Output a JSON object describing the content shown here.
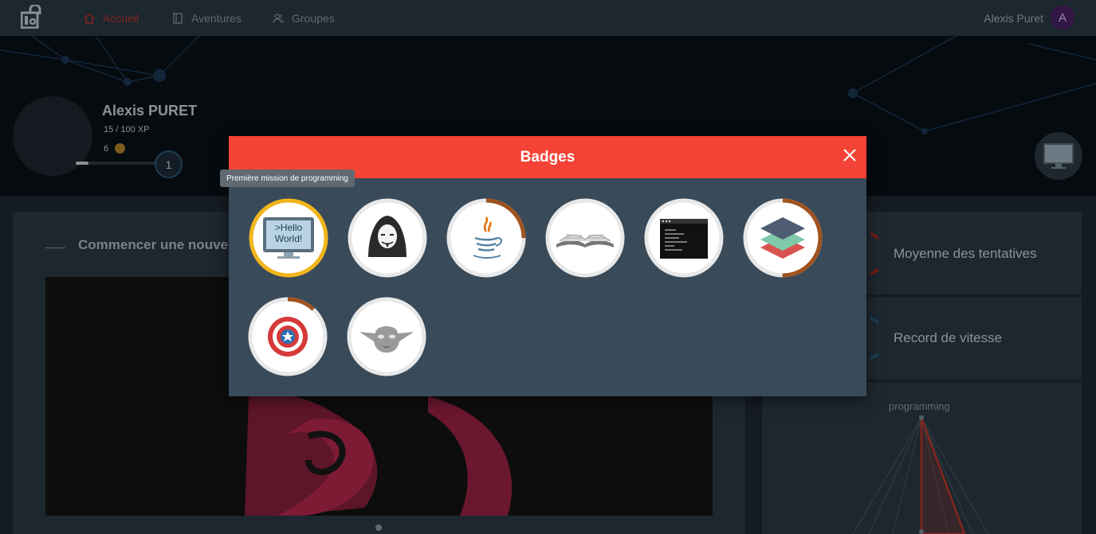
{
  "nav": {
    "items": [
      {
        "label": "Accueil",
        "icon": "home-icon",
        "active": true
      },
      {
        "label": "Aventures",
        "icon": "book-icon",
        "active": false
      },
      {
        "label": "Groupes",
        "icon": "users-icon",
        "active": false
      }
    ],
    "user_name": "Alexis Puret",
    "avatar_letter": "A"
  },
  "profile": {
    "name": "Alexis PURET",
    "xp": "15 / 100 XP",
    "xp_progress": 0.15,
    "coins": "6",
    "level": "1"
  },
  "main": {
    "card_title": "Commencer une nouve",
    "stats": [
      {
        "label": "Moyenne des tentatives"
      },
      {
        "label": "Record de vitesse"
      }
    ],
    "radar_axis_label": "programming"
  },
  "modal": {
    "title": "Badges",
    "tooltip": "Première mission de programming",
    "badges": [
      {
        "name": "hello-world-badge",
        "icon_text_1": ">Hello",
        "icon_text_2": "World!",
        "progress": 1.0,
        "ring_color": "#f1b51c"
      },
      {
        "name": "hacker-badge",
        "progress": 0.0,
        "ring_color": "#a0531f"
      },
      {
        "name": "java-badge",
        "progress": 0.25,
        "ring_color": "#a0531f"
      },
      {
        "name": "book-badge",
        "progress": 0.0,
        "ring_color": "#a0531f"
      },
      {
        "name": "terminal-badge",
        "progress": 0.0,
        "ring_color": "#a0531f"
      },
      {
        "name": "layers-badge",
        "progress": 0.5,
        "ring_color": "#a0531f"
      },
      {
        "name": "captain-shield-badge",
        "progress": 0.12,
        "ring_color": "#a0531f"
      },
      {
        "name": "yoda-badge",
        "progress": 0.0,
        "ring_color": "#a0531f"
      }
    ]
  },
  "colors": {
    "accent_red": "#f44336",
    "active_nav": "#c0392b",
    "ring_gold": "#f1b51c",
    "ring_bronze": "#a0531f"
  }
}
